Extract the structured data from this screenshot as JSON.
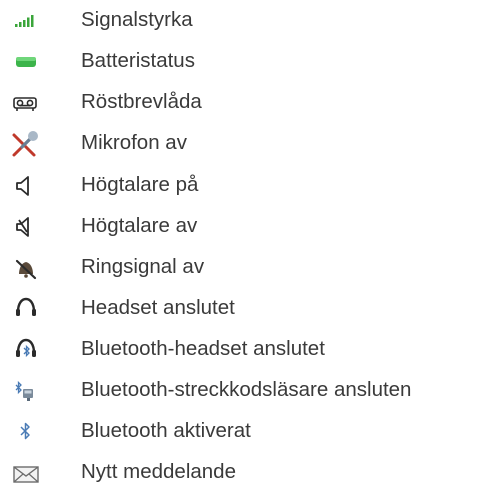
{
  "items": [
    {
      "icon": "signal-strength-icon",
      "label": "Signalstyrka"
    },
    {
      "icon": "battery-icon",
      "label": "Batteristatus"
    },
    {
      "icon": "voicemail-icon",
      "label": "Röstbrevlåda"
    },
    {
      "icon": "microphone-off-icon",
      "label": "Mikrofon av"
    },
    {
      "icon": "speaker-on-icon",
      "label": "Högtalare på"
    },
    {
      "icon": "speaker-off-icon",
      "label": "Högtalare av"
    },
    {
      "icon": "ringer-off-icon",
      "label": "Ringsignal av"
    },
    {
      "icon": "headset-icon",
      "label": "Headset anslutet"
    },
    {
      "icon": "bluetooth-headset-icon",
      "label": "Bluetooth-headset anslutet"
    },
    {
      "icon": "bluetooth-scanner-icon",
      "label": "Bluetooth-streckkodsläsare ansluten"
    },
    {
      "icon": "bluetooth-icon",
      "label": "Bluetooth aktiverat"
    },
    {
      "icon": "new-message-icon",
      "label": "Nytt meddelande"
    }
  ],
  "colors": {
    "text": "#3a3a3a",
    "signal": "#3aa53a",
    "battery": "#3cb44b",
    "icon_dark": "#2b2b2b",
    "bluetooth": "#4a7bb5"
  }
}
